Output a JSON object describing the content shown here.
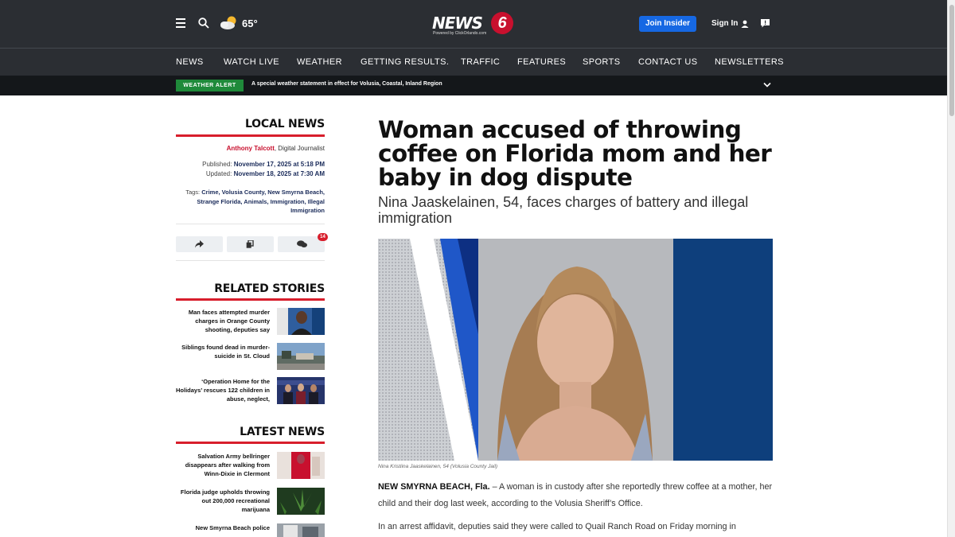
{
  "header": {
    "temperature": "65°",
    "logo_word": "NEWS",
    "logo_number": "6",
    "logo_sub": "Powered by ClickOrlando.com",
    "join_label": "Join Insider",
    "signin_label": "Sign In",
    "icons": [
      "menu-icon",
      "search-icon",
      "partly-cloudy-icon",
      "user-icon",
      "feedback-icon"
    ]
  },
  "nav": {
    "items": [
      "NEWS",
      "WATCH LIVE",
      "WEATHER",
      "GETTING RESULTS.",
      "TRAFFIC",
      "FEATURES",
      "SPORTS",
      "CONTACT US",
      "NEWSLETTERS"
    ]
  },
  "alert": {
    "badge": "WEATHER ALERT",
    "text": "A special weather statement in effect for Volusia, Coastal, Inland Region"
  },
  "sidebar": {
    "section_title": "LOCAL NEWS",
    "author": "Anthony Talcott",
    "author_role": ", Digital Journalist",
    "published_label": "Published: ",
    "published": "November 17, 2025 at 5:18 PM",
    "updated_label": "Updated: ",
    "updated": "November 18, 2025 at 7:30 AM",
    "tags_label": "Tags: ",
    "tags": "Crime, Volusia County, New Smyrna Beach, Strange Florida, Animals, Immigration, Illegal Immigration",
    "comment_count": "14",
    "related_title": "RELATED STORIES",
    "related": [
      {
        "title": "Man faces attempted murder charges in Orange County shooting, deputies say"
      },
      {
        "title": "Siblings found dead in murder-suicide in St. Cloud"
      },
      {
        "title": "‘Operation Home for the Holidays’ rescues 122 children in abuse, neglect,"
      }
    ],
    "latest_title": "LATEST NEWS",
    "latest": [
      {
        "title": "Salvation Army bellringer disappears after walking from Winn-Dixie in Clermont"
      },
      {
        "title": "Florida judge upholds throwing out 200,000 recreational marijuana"
      },
      {
        "title": "New Smyrna Beach police"
      }
    ]
  },
  "article": {
    "headline": "Woman accused of throwing coffee on Florida mom and her baby in dog dispute",
    "subhead": "Nina Jaaskelainen, 54, faces charges of battery and illegal immigration",
    "caption": "Nina Kristiina Jaaskelainen, 54 (Volusia County Jail)",
    "dateline": "NEW SMYRNA BEACH, Fla.",
    "para1": " – A woman is in custody after she reportedly threw coffee at a mother, her child and their dog last week, according to the Volusia Sheriff’s Office.",
    "para2": "In an arrest affidavit, deputies said they were called to Quail Ranch Road on Friday morning in reference"
  },
  "colors": {
    "header_bg": "#2b2e33",
    "accent_red": "#d81e2c",
    "join_blue": "#1668e3",
    "alert_green": "#1f8a3a"
  }
}
